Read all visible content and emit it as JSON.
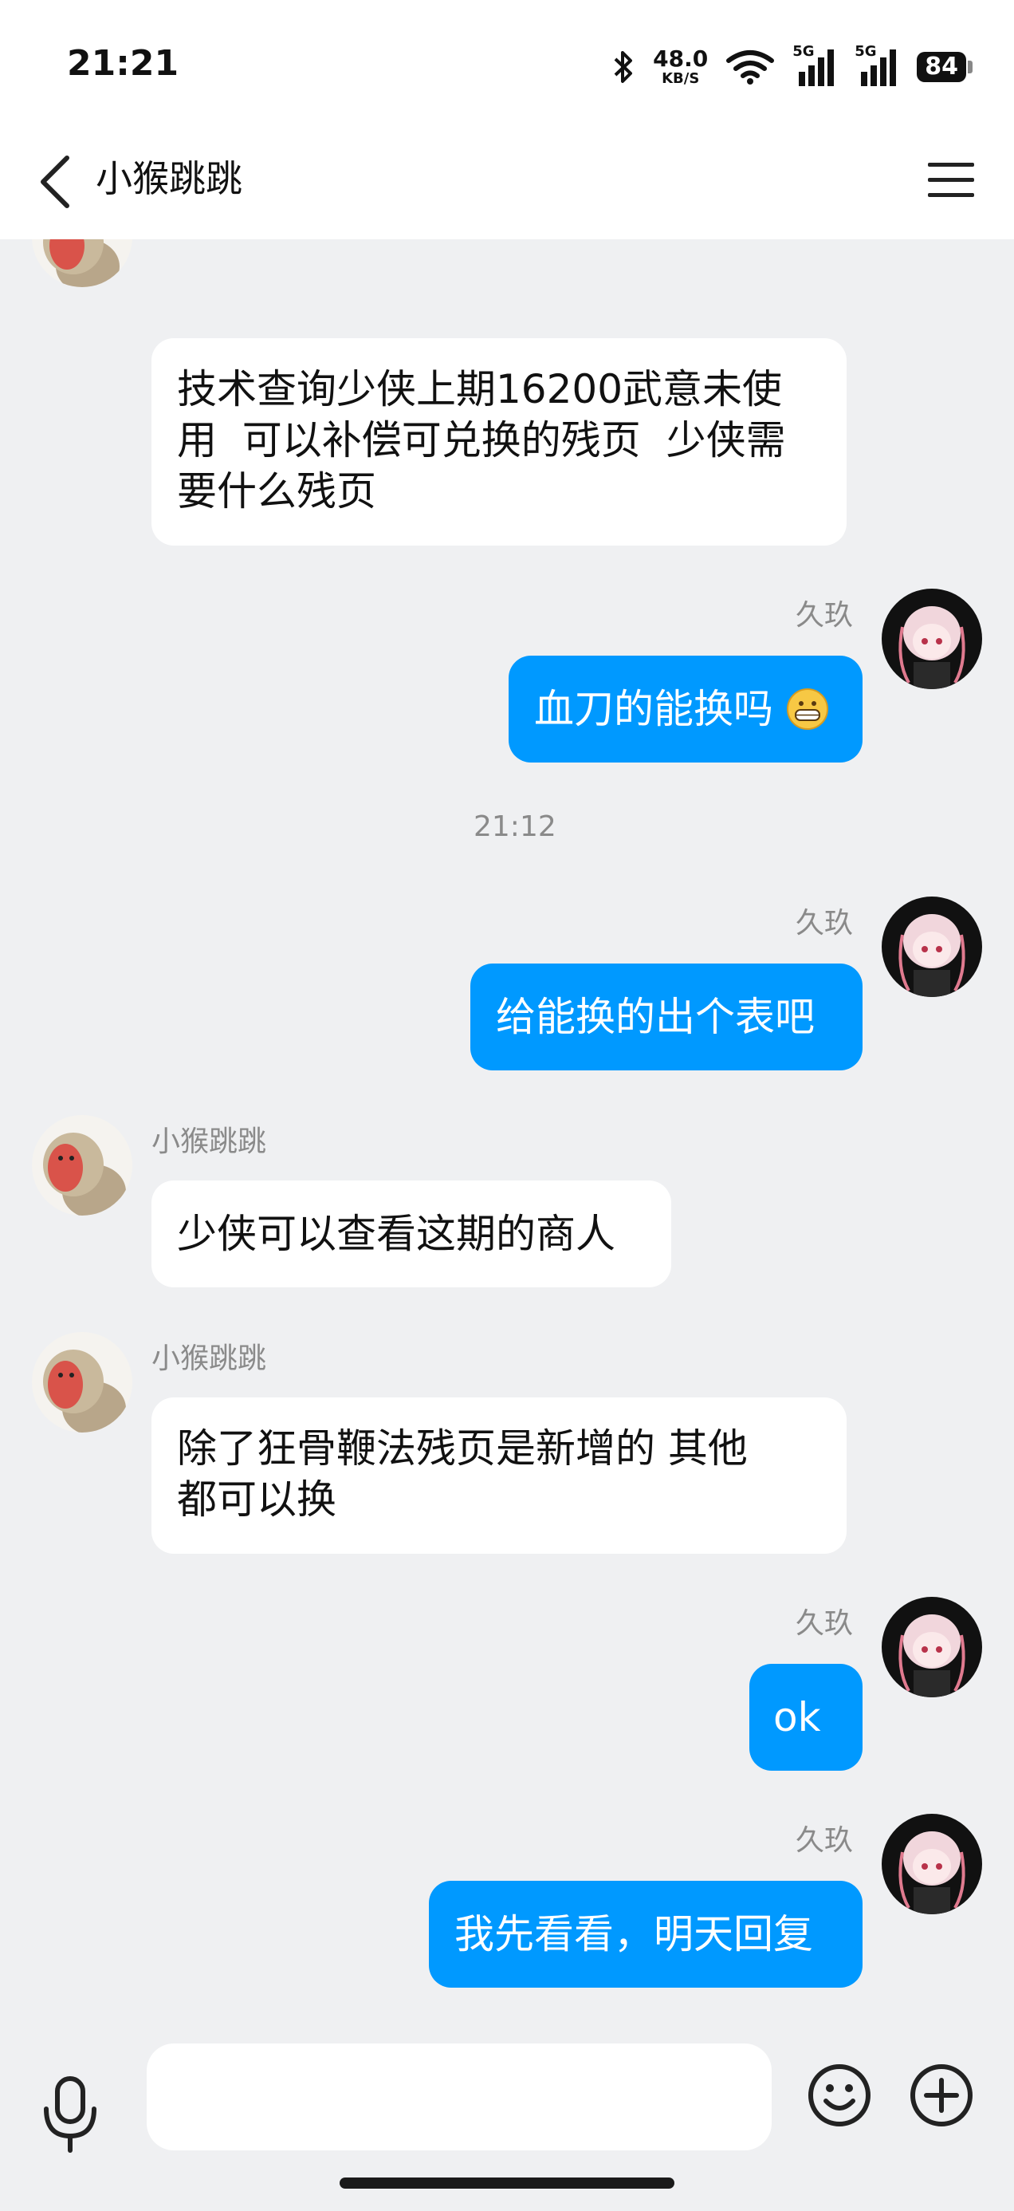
{
  "status_bar": {
    "time": "21:21",
    "net_speed_value": "48.0",
    "net_speed_unit": "KB/S",
    "signal_1_label": "5G",
    "signal_2_label": "5G",
    "battery_level": "84"
  },
  "header": {
    "title": "小猴跳跳"
  },
  "messages": [
    {
      "direction": "in",
      "sender": "",
      "text_lines": [
        "技术查询少侠上期16200武意未使",
        "用  可以补偿可兑换的残页  少侠需",
        "要什么残页"
      ]
    },
    {
      "direction": "out",
      "sender": "久玖",
      "text": "血刀的能换吗",
      "emoji": "grinning-face-emoji"
    },
    {
      "type": "timestamp",
      "text": "21:12"
    },
    {
      "direction": "out",
      "sender": "久玖",
      "text": "给能换的出个表吧"
    },
    {
      "direction": "in",
      "sender": "小猴跳跳",
      "text": "少侠可以查看这期的商人"
    },
    {
      "direction": "in",
      "sender": "小猴跳跳",
      "text_lines": [
        "除了狂骨鞭法残页是新增的 其他",
        "都可以换"
      ]
    },
    {
      "direction": "out",
      "sender": "久玖",
      "text": "ok"
    },
    {
      "direction": "out",
      "sender": "久玖",
      "text": "我先看看，明天回复"
    }
  ],
  "input": {
    "value": "",
    "placeholder": ""
  },
  "icons": {
    "back": "chevron-left-icon",
    "menu": "hamburger-menu-icon",
    "mic": "microphone-icon",
    "emoji": "smiley-icon",
    "plus": "plus-circle-icon"
  },
  "colors": {
    "outgoing_bubble": "#0099ff",
    "incoming_bubble": "#ffffff",
    "background": "#eff0f2"
  }
}
